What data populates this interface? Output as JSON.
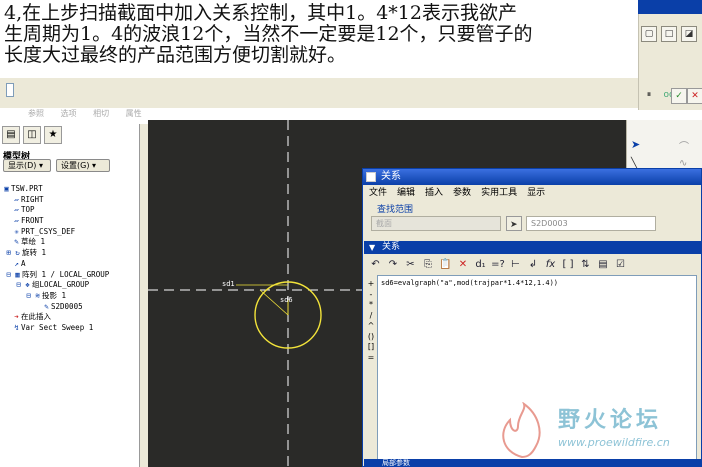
{
  "caption": {
    "line1": "4,在上步扫描截面中加入关系控制，其中1。4*12表示我欲产",
    "line2": "生周期为1。4的波浪12个，当然不一定要是12个，只要管子的",
    "line3": "长度大过最终的产品范围方便切割就好。"
  },
  "dashboard_tabs": [
    "参照",
    "选项",
    "相切",
    "属性"
  ],
  "left_panel": {
    "title": "模型树",
    "show_button": "显示(D) ▾",
    "settings_button": "设置(G) ▾",
    "tree": [
      {
        "icon": "part",
        "label": "TSW.PRT"
      },
      {
        "icon": "plane",
        "label": "RIGHT"
      },
      {
        "icon": "plane",
        "label": "TOP"
      },
      {
        "icon": "plane",
        "label": "FRONT"
      },
      {
        "icon": "csys",
        "label": "PRT_CSYS_DEF"
      },
      {
        "icon": "sketch",
        "label": "草绘 1"
      },
      {
        "icon": "revolve",
        "label": "旋转 1"
      },
      {
        "icon": "axis",
        "label": "A"
      },
      {
        "icon": "pattern",
        "label": "阵列 1 / LOCAL_GROUP"
      },
      {
        "icon": "group",
        "label": "组LOCAL_GROUP"
      },
      {
        "icon": "projection",
        "label": "投影 1"
      },
      {
        "icon": "feature",
        "label": "S2D0005"
      },
      {
        "icon": "insert",
        "label": "在此插入"
      },
      {
        "icon": "sweep",
        "label": "Var Sect Sweep 1"
      }
    ]
  },
  "sketch": {
    "dim_left": "sd1",
    "dim_right": "sd6"
  },
  "relations_dialog": {
    "title": "关系",
    "menu": [
      "文件",
      "编辑",
      "插入",
      "参数",
      "实用工具",
      "显示"
    ],
    "scope_label": "查找范围",
    "scope_value": "截面",
    "scope_field": "S2D0003",
    "section_title": "关系",
    "operators": [
      "+",
      "-",
      "*",
      "/",
      "^",
      "()",
      "[]",
      "="
    ],
    "relation_text": "sd6=evalgraph(\"a\",mod(trajpar*1.4*12,1.4))",
    "bottom_section": "局部参数"
  },
  "watermark": {
    "name": "野火论坛",
    "url": "www.proewildfire.cn"
  },
  "colors": {
    "graphics_bg": "#2a2a28",
    "sketch_circle": "#f2e33a",
    "dialog_title": "#0a3fa8"
  }
}
